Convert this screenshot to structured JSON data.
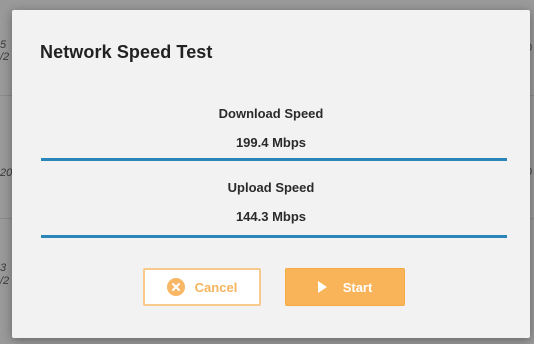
{
  "background": {
    "fragments_left": [
      "5",
      "/2",
      "20",
      "3",
      "/2"
    ],
    "fragments_right": [
      "0",
      "0"
    ]
  },
  "dialog": {
    "title": "Network Speed Test",
    "download": {
      "label": "Download Speed",
      "value": "199.4 Mbps",
      "progress_percent": 100
    },
    "upload": {
      "label": "Upload Speed",
      "value": "144.3 Mbps",
      "progress_percent": 100
    },
    "buttons": {
      "cancel_label": "Cancel",
      "start_label": "Start"
    }
  },
  "colors": {
    "accent": "#f9b358",
    "progress": "#2a86b8",
    "dialog_bg": "#f2f2f2"
  },
  "icons": {
    "cancel": "close-circle-icon",
    "start": "play-icon"
  }
}
